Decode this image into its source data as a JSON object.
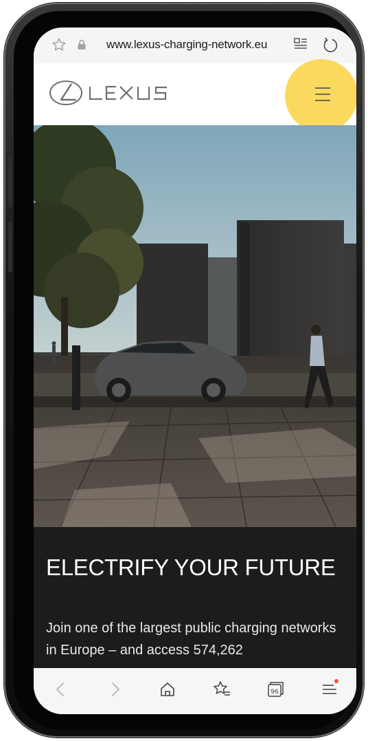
{
  "browser": {
    "url": "www.lexus-charging-network.eu",
    "tab_count": "96",
    "icons": [
      "favourite-star-icon",
      "lock-icon",
      "reader-mode-icon",
      "reload-icon",
      "back-icon",
      "forward-icon",
      "home-icon",
      "bookmarks-icon",
      "tabs-icon",
      "menu-icon"
    ]
  },
  "site": {
    "brand": "LEXUS",
    "highlight_color": "#fbd95e"
  },
  "hero": {
    "headline": "ELECTRIFY YOUR FUTURE",
    "body": "Join one of the largest public charging networks in Europe – and access 574,262"
  },
  "colors": {
    "panel": "#1c1c1c",
    "notification_dot": "#e85a2c"
  }
}
